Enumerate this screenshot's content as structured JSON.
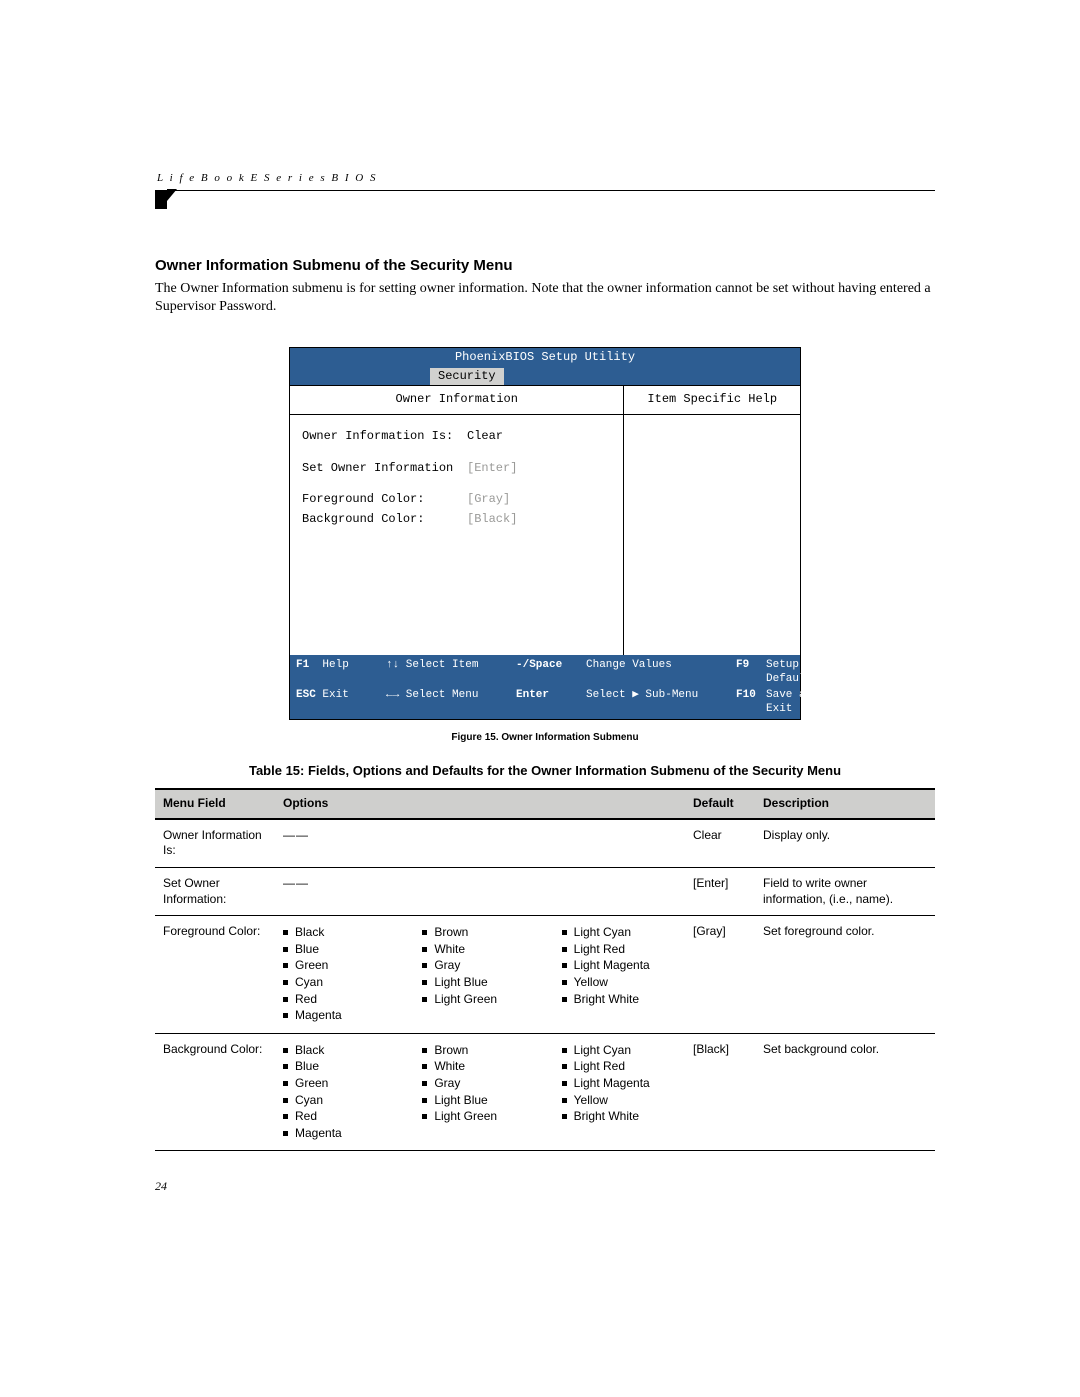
{
  "running_head": "L i f e B o o k   E   S e r i e s   B I O S",
  "section_title": "Owner Information Submenu of the Security Menu",
  "section_body": "The Owner Information submenu is for setting owner information. Note that the owner information cannot be set without having entered a Supervisor Password.",
  "bios": {
    "title": "PhoenixBIOS Setup Utility",
    "tab": "Security",
    "left_header": "Owner Information",
    "right_header": "Item Specific Help",
    "rows": [
      {
        "label": "Owner Information Is:",
        "value": "Clear",
        "dim": false
      },
      {
        "label": "Set Owner Information",
        "value": "[Enter]",
        "dim": true
      },
      {
        "label": "Foreground Color:",
        "value": "[Gray]",
        "dim": true
      },
      {
        "label": "Background Color:",
        "value": "[Black]",
        "dim": true
      }
    ],
    "footer": {
      "f1": "F1",
      "f1_label": "Help",
      "nav1": "↑↓ Select Item",
      "chg_key": "-/Space",
      "chg_label": "Change Values",
      "f9": "F9",
      "f9_label": "Setup Defaults",
      "esc": "ESC",
      "esc_label": "Exit",
      "nav2": "←→ Select Menu",
      "ent_key": "Enter",
      "ent_label": "Select ▶ Sub-Menu",
      "f10": "F10",
      "f10_label": "Save and Exit"
    }
  },
  "figure_caption": "Figure 15.  Owner Information Submenu",
  "table_caption": "Table 15: Fields, Options and Defaults for the Owner Information Submenu of the Security Menu",
  "table": {
    "headers": [
      "Menu Field",
      "Options",
      "Default",
      "Description"
    ],
    "rows": [
      {
        "field": "Owner Information Is:",
        "options_dash": true,
        "default": "Clear",
        "desc": "Display only."
      },
      {
        "field": "Set Owner Information:",
        "options_dash": true,
        "default": "[Enter]",
        "desc": "Field to write owner information, (i.e., name)."
      },
      {
        "field": "Foreground Color:",
        "options": [
          [
            "Black",
            "Blue",
            "Green",
            "Cyan",
            "Red",
            "Magenta"
          ],
          [
            "Brown",
            "White",
            "Gray",
            "Light Blue",
            "Light Green"
          ],
          [
            "Light Cyan",
            "Light Red",
            "Light Magenta",
            "Yellow",
            "Bright White"
          ]
        ],
        "default": "[Gray]",
        "desc": "Set foreground color."
      },
      {
        "field": "Background Color:",
        "options": [
          [
            "Black",
            "Blue",
            "Green",
            "Cyan",
            "Red",
            "Magenta"
          ],
          [
            "Brown",
            "White",
            "Gray",
            "Light Blue",
            "Light Green"
          ],
          [
            "Light Cyan",
            "Light Red",
            "Light Magenta",
            "Yellow",
            "Bright White"
          ]
        ],
        "default": "[Black]",
        "desc": "Set background color."
      }
    ]
  },
  "page_number": "24"
}
